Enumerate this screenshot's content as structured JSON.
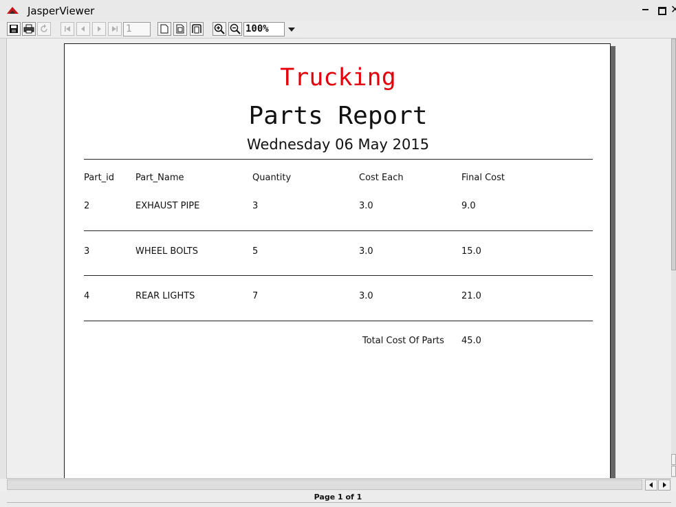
{
  "window": {
    "title": "JasperViewer"
  },
  "toolbar": {
    "page_number": "1",
    "zoom": "100%",
    "icons": [
      "save-icon",
      "print-icon",
      "reload-icon",
      "first-page-icon",
      "previous-page-icon",
      "next-page-icon",
      "last-page-icon",
      "actual-size-icon",
      "fit-page-icon",
      "fit-width-icon",
      "zoom-in-icon",
      "zoom-out-icon",
      "dropdown-arrow-icon"
    ]
  },
  "report": {
    "company_name": "Trucking",
    "company_color": "#e3000b",
    "title": "Parts Report",
    "date": "Wednesday 06 May 2015",
    "columns": [
      "Part_id",
      "Part_Name",
      "Quantity",
      "Cost Each",
      "Final Cost"
    ],
    "rows": [
      [
        "2",
        "EXHAUST PIPE",
        "3",
        "3.0",
        "9.0"
      ],
      [
        "3",
        "WHEEL BOLTS",
        "5",
        "3.0",
        "15.0"
      ],
      [
        "4",
        "REAR LIGHTS",
        "7",
        "3.0",
        "21.0"
      ]
    ],
    "total_label": "Total Cost Of Parts",
    "total_value": "45.0"
  },
  "status": {
    "page_indicator": "Page 1 of 1"
  }
}
